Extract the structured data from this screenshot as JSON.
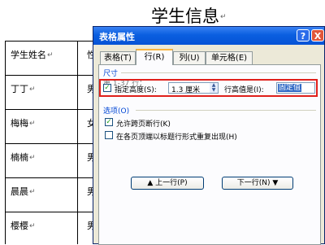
{
  "document": {
    "title": "学生信息",
    "paragraph_mark": "↵",
    "table": {
      "rows": [
        {
          "name": "学生姓名",
          "col2": "性"
        },
        {
          "name": "丁丁",
          "col2": "男"
        },
        {
          "name": "梅梅",
          "col2": "女"
        },
        {
          "name": "楠楠",
          "col2": "男"
        },
        {
          "name": "晨晨",
          "col2": "男"
        },
        {
          "name": "樱樱",
          "col2": "男"
        }
      ]
    }
  },
  "dialog": {
    "title": "表格属性",
    "help_icon": "?",
    "close_icon": "X",
    "tabs": [
      {
        "label": "表格(T)"
      },
      {
        "label": "行(R)"
      },
      {
        "label": "列(U)"
      },
      {
        "label": "单元格(E)"
      }
    ],
    "size_section": "尺寸",
    "row_number": "第 1-37 行：",
    "specify_height": {
      "checked": true,
      "label": "指定高度(S):",
      "value": "1.3 厘米",
      "row_height_label": "行高值是(I):",
      "row_height_value": "固定值"
    },
    "options_section": "选项(O)",
    "allow_break": {
      "checked": true,
      "label": "允许跨页断行(K)"
    },
    "repeat_header": {
      "checked": false,
      "label": "在各页顶端以标题行形式重复出现(H)"
    },
    "prev_row_button": "上一行(P)",
    "next_row_button": "下一行(N)"
  }
}
